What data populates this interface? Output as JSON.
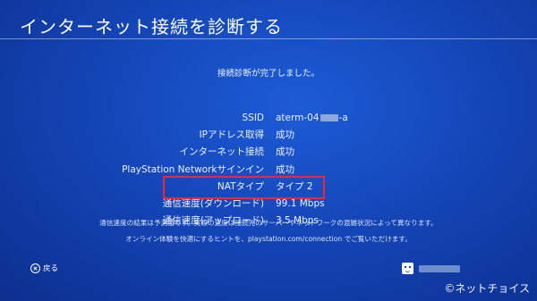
{
  "header": {
    "title": "インターネット接続を診断する"
  },
  "status": {
    "message": "接続診断が完了しました。"
  },
  "results": [
    {
      "label": "SSID",
      "value_prefix": "aterm-04",
      "value_suffix": "-a"
    },
    {
      "label": "IPアドレス取得",
      "value": "成功"
    },
    {
      "label": "インターネット接続",
      "value": "成功"
    },
    {
      "label": "PlayStation Networkサインイン",
      "value": "成功"
    },
    {
      "label": "NATタイプ",
      "value": "タイプ 2"
    },
    {
      "label": "通信速度(ダウンロード)",
      "value": "99.1 Mbps"
    },
    {
      "label": "通信速度(アップロード)",
      "value": "3.5 Mbps"
    }
  ],
  "notes": {
    "line1": "通信速度の結果は予測値です。実際の速度は接続先のサーバーやネットワークの混雑状況によって異なります。",
    "line2": "オンライン体験を快適にするヒントを、playstation.com/connection でご覧いただけます。"
  },
  "footer": {
    "back_label": "戻る"
  },
  "watermark": {
    "text": "©ネットチョイス"
  },
  "colors": {
    "background": "#1446b8",
    "highlight": "#e8283c"
  },
  "icons": {
    "back": "cross-button-icon",
    "user": "avatar-icon"
  }
}
